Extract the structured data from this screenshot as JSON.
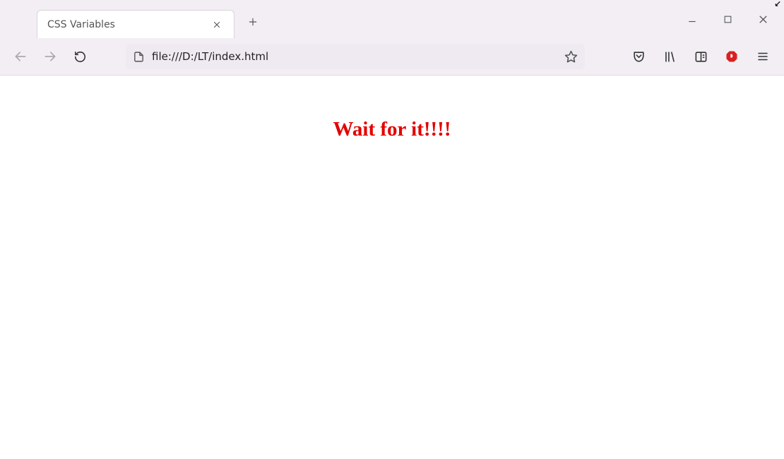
{
  "tab": {
    "title": "CSS Variables"
  },
  "addressbar": {
    "url": "file:///D:/LT/index.html"
  },
  "page": {
    "heading": "Wait for it!!!!",
    "headingColor": "#e30000"
  }
}
